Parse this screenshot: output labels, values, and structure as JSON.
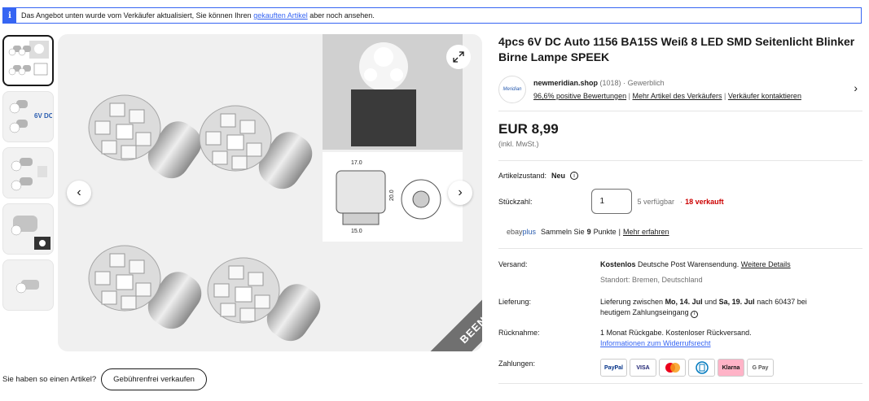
{
  "notice": {
    "text_before": "Das Angebot unten wurde vom Verkäufer aktualisiert, Sie können Ihren",
    "link": "gekauften Artikel",
    "text_after": "aber noch ansehen."
  },
  "gallery": {
    "ribbon": "BEENDET"
  },
  "sell": {
    "question": "Sie haben so einen Artikel?",
    "button": "Gebührenfrei verkaufen"
  },
  "item": {
    "title": "4pcs 6V DC Auto 1156 BA15S Weiß 8 LED SMD Seitenlicht Blinker Birne Lampe SPEEK"
  },
  "seller": {
    "logo_text": "Meridian",
    "name": "newmeridian.shop",
    "count": "(1018)",
    "type": "Gewerblich",
    "rating": "96,6% positive Bewertungen",
    "more": "Mehr Artikel des Verkäufers",
    "contact": "Verkäufer kontaktieren"
  },
  "price": {
    "amount": "EUR 8,99",
    "vat": "(inkl. MwSt.)"
  },
  "condition": {
    "label": "Artikelzustand:",
    "value": "Neu"
  },
  "quantity": {
    "label": "Stückzahl:",
    "value": "1",
    "available": "5 verfügbar",
    "sold": "18 verkauft"
  },
  "ebayplus": {
    "brand_a": "ebay",
    "brand_b": "plus",
    "text": "Sammeln Sie",
    "points": "9",
    "unit": "Punkte",
    "link": "Mehr erfahren"
  },
  "shipping": {
    "label": "Versand:",
    "free": "Kostenlos",
    "method": "Deutsche Post Warensendung.",
    "link": "Weitere Details",
    "location": "Standort: Bremen, Deutschland"
  },
  "delivery": {
    "label": "Lieferung:",
    "line1_pre": "Lieferung zwischen",
    "date1": "Mo, 14. Jul",
    "and": "und",
    "date2": "Sa, 19. Jul",
    "line1_post": "nach 60437 bei",
    "line2": "heutigem Zahlungseingang"
  },
  "returns": {
    "label": "Rücknahme:",
    "text": "1 Monat Rückgabe. Kostenloser Rückversand.",
    "link": "Informationen zum Widerrufsrecht"
  },
  "payments": {
    "label": "Zahlungen:",
    "methods": [
      "PayPal",
      "VISA",
      "MC",
      "Diners",
      "Klarna",
      "G Pay"
    ]
  },
  "colors": {
    "accent": "#3665f3",
    "sold": "#cc0000",
    "klarna": "#ffb3c7"
  }
}
